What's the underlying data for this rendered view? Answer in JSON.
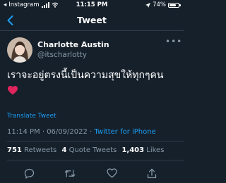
{
  "status_bar": {
    "back_app": "Instagram",
    "time": "11:15 PM",
    "battery": "74%",
    "battery_level": 0.74
  },
  "header": {
    "title": "Tweet"
  },
  "tweet": {
    "author_name": "Charlotte Austin",
    "author_handle": "@itscharlotty",
    "text": "เราจะอยู่ตรงนี้เป็นความสุขให้ทุกๆคน",
    "emoji_icon": "red-heart-icon",
    "translate_label": "Translate Tweet",
    "timestamp": "11:14 PM · 06/09/2022 · ",
    "source": "Twitter for iPhone"
  },
  "stats": {
    "retweets_count": "751",
    "retweets_label": "Retweets",
    "quotes_count": "4",
    "quotes_label": "Quote Tweets",
    "likes_count": "1,403",
    "likes_label": "Likes"
  },
  "actions": [
    "reply-icon",
    "retweet-icon",
    "like-icon",
    "share-icon"
  ],
  "colors": {
    "background": "#15202b",
    "accent": "#1d9bf0",
    "secondary_text": "#8899a6",
    "divider": "#2f3d4a",
    "heart": "#e0245e"
  }
}
